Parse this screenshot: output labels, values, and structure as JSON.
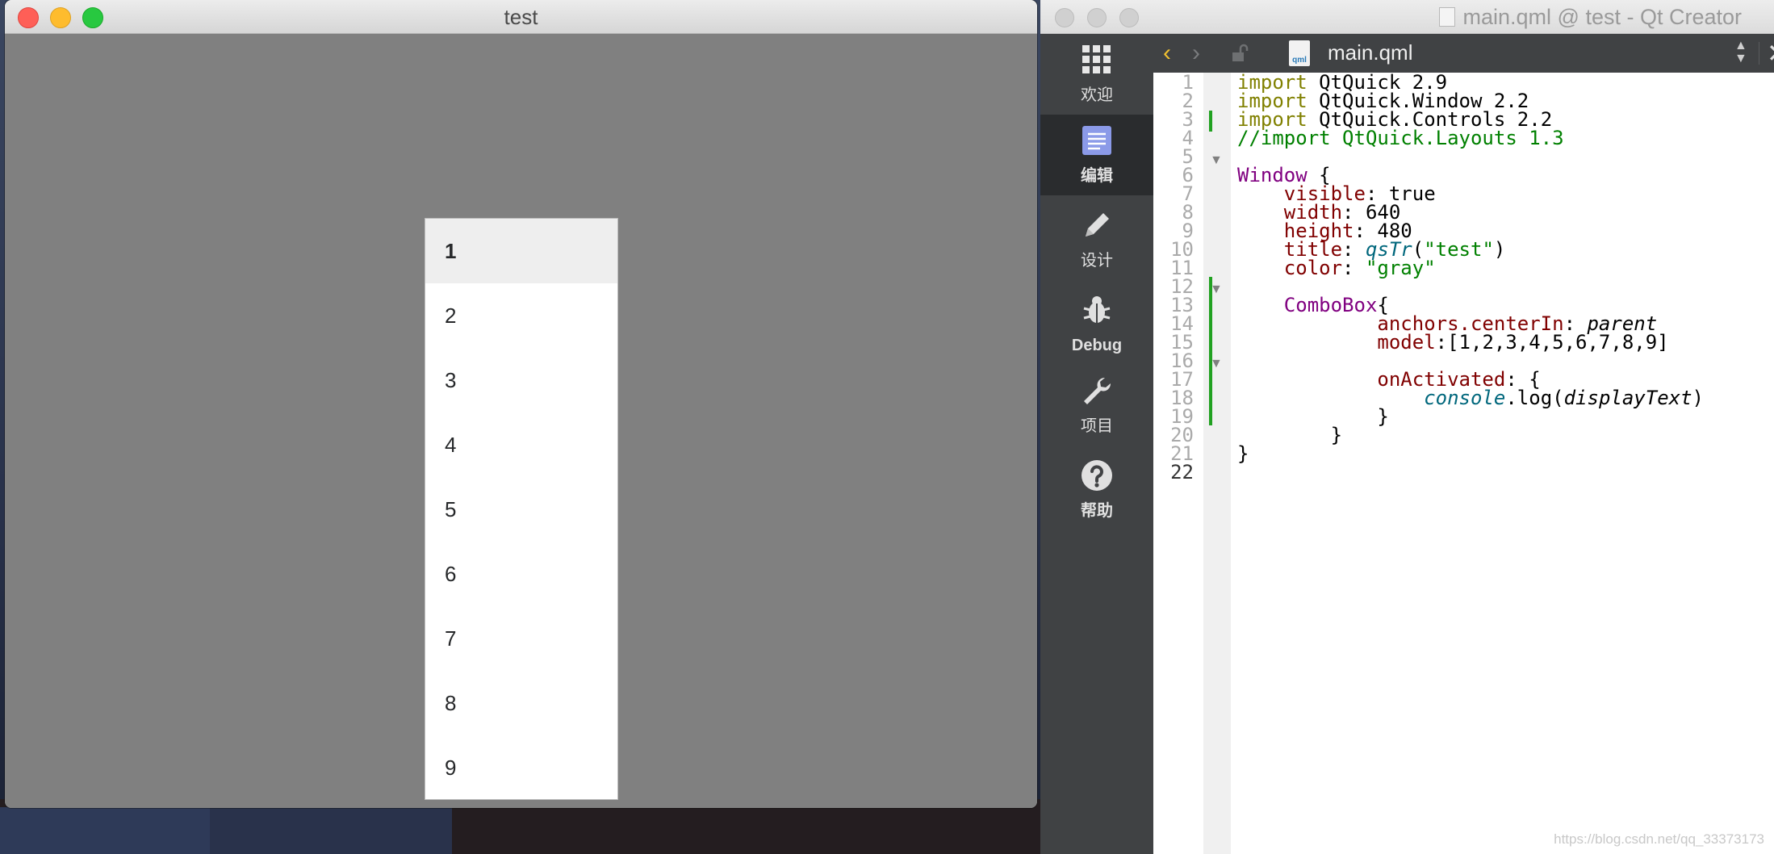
{
  "test_window": {
    "title": "test",
    "combo_popup": {
      "items": [
        "1",
        "2",
        "3",
        "4",
        "5",
        "6",
        "7",
        "8",
        "9"
      ],
      "selected_index": 0
    }
  },
  "qt_creator": {
    "window_title": "main.qml @ test - Qt Creator",
    "modes": [
      {
        "label": "欢迎",
        "icon": "grid-icon"
      },
      {
        "label": "编辑",
        "icon": "document-icon"
      },
      {
        "label": "设计",
        "icon": "pencil-icon"
      },
      {
        "label": "Debug",
        "icon": "bug-icon"
      },
      {
        "label": "项目",
        "icon": "wrench-icon"
      },
      {
        "label": "帮助",
        "icon": "help-icon"
      }
    ],
    "active_mode": "编辑",
    "toolbar": {
      "back": "‹",
      "forward": "›",
      "file_badge": "qml",
      "file_name": "main.qml",
      "close": "✕"
    },
    "line_numbers": [
      "1",
      "2",
      "3",
      "4",
      "5",
      "6",
      "7",
      "8",
      "9",
      "10",
      "11",
      "12",
      "13",
      "14",
      "15",
      "16",
      "17",
      "18",
      "19",
      "20",
      "21",
      "22"
    ],
    "code_lines": [
      [
        {
          "t": "kw",
          "s": "import"
        },
        {
          "t": "",
          "s": " QtQuick 2.9"
        }
      ],
      [
        {
          "t": "kw",
          "s": "import"
        },
        {
          "t": "",
          "s": " QtQuick.Window 2.2"
        }
      ],
      [
        {
          "t": "kw",
          "s": "import"
        },
        {
          "t": "",
          "s": " QtQuick.Controls 2.2"
        }
      ],
      [
        {
          "t": "cm",
          "s": "//import QtQuick.Layouts 1.3"
        }
      ],
      [],
      [
        {
          "t": "ty",
          "s": "Window"
        },
        {
          "t": "",
          "s": " {"
        }
      ],
      [
        {
          "t": "",
          "s": "    "
        },
        {
          "t": "pr",
          "s": "visible"
        },
        {
          "t": "",
          "s": ": true"
        }
      ],
      [
        {
          "t": "",
          "s": "    "
        },
        {
          "t": "pr",
          "s": "width"
        },
        {
          "t": "",
          "s": ": 640"
        }
      ],
      [
        {
          "t": "",
          "s": "    "
        },
        {
          "t": "pr",
          "s": "height"
        },
        {
          "t": "",
          "s": ": 480"
        }
      ],
      [
        {
          "t": "",
          "s": "    "
        },
        {
          "t": "pr",
          "s": "title"
        },
        {
          "t": "",
          "s": ": "
        },
        {
          "t": "fn",
          "s": "qsTr"
        },
        {
          "t": "",
          "s": "("
        },
        {
          "t": "st",
          "s": "\"test\""
        },
        {
          "t": "",
          "s": ")"
        }
      ],
      [
        {
          "t": "",
          "s": "    "
        },
        {
          "t": "pr",
          "s": "color"
        },
        {
          "t": "",
          "s": ": "
        },
        {
          "t": "st",
          "s": "\"gray\""
        }
      ],
      [],
      [
        {
          "t": "",
          "s": "    "
        },
        {
          "t": "ty",
          "s": "ComboBox"
        },
        {
          "t": "",
          "s": "{"
        }
      ],
      [
        {
          "t": "",
          "s": "            "
        },
        {
          "t": "pr",
          "s": "anchors.centerIn"
        },
        {
          "t": "",
          "s": ": "
        },
        {
          "t": "it",
          "s": "parent"
        }
      ],
      [
        {
          "t": "",
          "s": "            "
        },
        {
          "t": "pr",
          "s": "model"
        },
        {
          "t": "",
          "s": ":[1,2,3,4,5,6,7,8,9]"
        }
      ],
      [],
      [
        {
          "t": "",
          "s": "            "
        },
        {
          "t": "pr",
          "s": "onActivated"
        },
        {
          "t": "",
          "s": ": {"
        }
      ],
      [
        {
          "t": "",
          "s": "                "
        },
        {
          "t": "fn",
          "s": "console"
        },
        {
          "t": "",
          "s": ".log("
        },
        {
          "t": "it",
          "s": "displayText"
        },
        {
          "t": "",
          "s": ")"
        }
      ],
      [
        {
          "t": "",
          "s": "            }"
        }
      ],
      [
        {
          "t": "",
          "s": "        }"
        }
      ],
      [
        {
          "t": "",
          "s": "}"
        }
      ],
      []
    ],
    "current_line": "22",
    "watermark": "https://blog.csdn.net/qq_33373173"
  }
}
